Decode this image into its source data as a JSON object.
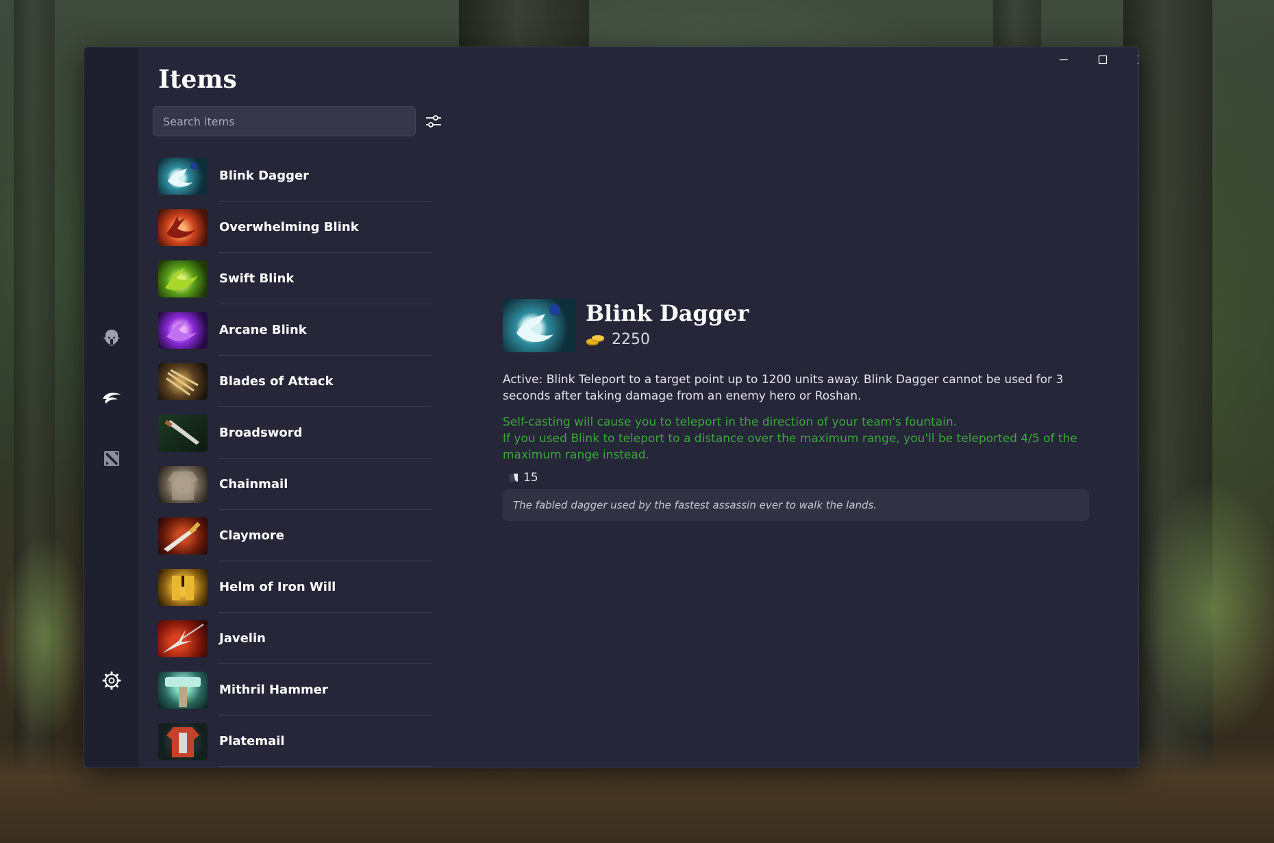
{
  "app": {
    "title": "Items"
  },
  "search": {
    "placeholder": "Search items",
    "value": ""
  },
  "items": [
    {
      "name": "Blink Dagger",
      "icon": "blink-dagger-icon"
    },
    {
      "name": "Overwhelming Blink",
      "icon": "overwhelming-blink-icon"
    },
    {
      "name": "Swift Blink",
      "icon": "swift-blink-icon"
    },
    {
      "name": "Arcane Blink",
      "icon": "arcane-blink-icon"
    },
    {
      "name": "Blades of Attack",
      "icon": "blades-of-attack-icon"
    },
    {
      "name": "Broadsword",
      "icon": "broadsword-icon"
    },
    {
      "name": "Chainmail",
      "icon": "chainmail-icon"
    },
    {
      "name": "Claymore",
      "icon": "claymore-icon"
    },
    {
      "name": "Helm of Iron Will",
      "icon": "helm-of-iron-will-icon"
    },
    {
      "name": "Javelin",
      "icon": "javelin-icon"
    },
    {
      "name": "Mithril Hammer",
      "icon": "mithril-hammer-icon"
    },
    {
      "name": "Platemail",
      "icon": "platemail-icon"
    }
  ],
  "detail": {
    "name": "Blink Dagger",
    "cost": "2250",
    "description": "Active: Blink Teleport to a target point up to 1200 units away. Blink Dagger cannot be used for 3 seconds after taking damage from an enemy hero or Roshan.",
    "note_line1": "Self-casting will cause you to teleport in the direction of your team's fountain.",
    "note_line2": "If you used Blink to teleport to a distance over the maximum range, you'll be teleported 4/5 of the maximum range instead.",
    "cooldown": "15",
    "lore": "The fabled dagger used by the fastest assassin ever to walk the lands."
  },
  "colors": {
    "window_bg": "#252638",
    "rail_bg": "#1f202f",
    "note_green": "#3ea53e",
    "accent_gold": "#e6b422"
  }
}
